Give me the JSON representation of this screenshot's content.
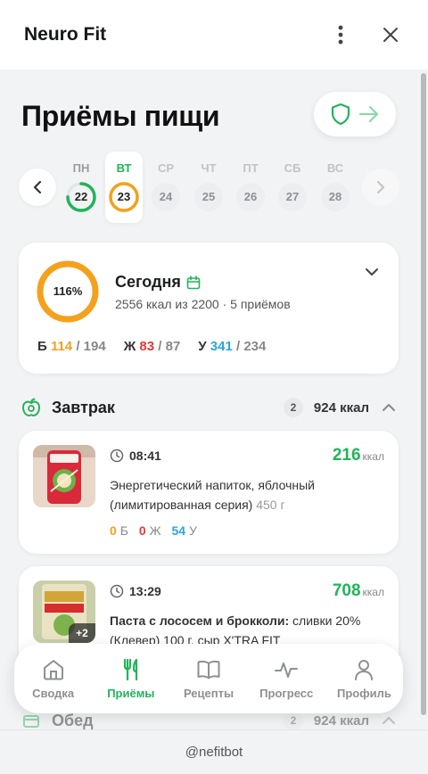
{
  "app": {
    "title": "Neuro Fit"
  },
  "page": {
    "title": "Приёмы пищи"
  },
  "colors": {
    "green": "#22b35a",
    "orange": "#f4a11d",
    "red": "#e53935",
    "blue": "#2aa6e0"
  },
  "week": [
    {
      "name": "ПН",
      "num": "22",
      "state": "green",
      "progress": 0.75
    },
    {
      "name": "ВТ",
      "num": "23",
      "state": "orange-selected",
      "progress": 1.0
    },
    {
      "name": "СР",
      "num": "24",
      "state": "future"
    },
    {
      "name": "ЧТ",
      "num": "25",
      "state": "future"
    },
    {
      "name": "ПТ",
      "num": "26",
      "state": "future"
    },
    {
      "name": "СБ",
      "num": "27",
      "state": "future"
    },
    {
      "name": "ВС",
      "num": "28",
      "state": "future"
    }
  ],
  "summary": {
    "percent": "116%",
    "label": "Сегодня",
    "kcal_text": "2556 ккал из 2200 · 5 приёмов",
    "macros": [
      {
        "label": "Б",
        "value": "114",
        "total": "/ 194",
        "color": "#f4a11d"
      },
      {
        "label": "Ж",
        "value": "83",
        "total": "/ 87",
        "color": "#e53935"
      },
      {
        "label": "У",
        "value": "341",
        "total": "/ 234",
        "color": "#2aa6e0"
      }
    ]
  },
  "breakfast": {
    "title": "Завтрак",
    "count": "2",
    "kcal": "924 ккал",
    "items": [
      {
        "time": "08:41",
        "kcal": "216",
        "unit": "ккал",
        "name_bold": "",
        "name": "Энергетический напиток, яблочный (лимитированная серия)",
        "weight": "450 г",
        "p": "0",
        "p_l": "Б",
        "f": "0",
        "f_l": "Ж",
        "c": "54",
        "c_l": "У"
      },
      {
        "time": "13:29",
        "kcal": "708",
        "unit": "ккал",
        "name_bold": "Паста с лососем и брокколи:",
        "name": "сливки 20% (Клевер) 100 г, сыр X'TRA FIT",
        "more": "+2"
      }
    ]
  },
  "lunch": {
    "title": "Обед",
    "count": "2",
    "kcal": "924 ккал"
  },
  "tabs": [
    {
      "label": "Сводка",
      "icon": "home-icon"
    },
    {
      "label": "Приёмы",
      "icon": "fork-knife-icon",
      "active": true
    },
    {
      "label": "Рецепты",
      "icon": "book-icon"
    },
    {
      "label": "Прогресс",
      "icon": "pulse-icon"
    },
    {
      "label": "Профиль",
      "icon": "user-icon"
    }
  ],
  "footer": {
    "text": "@nefitbot"
  }
}
